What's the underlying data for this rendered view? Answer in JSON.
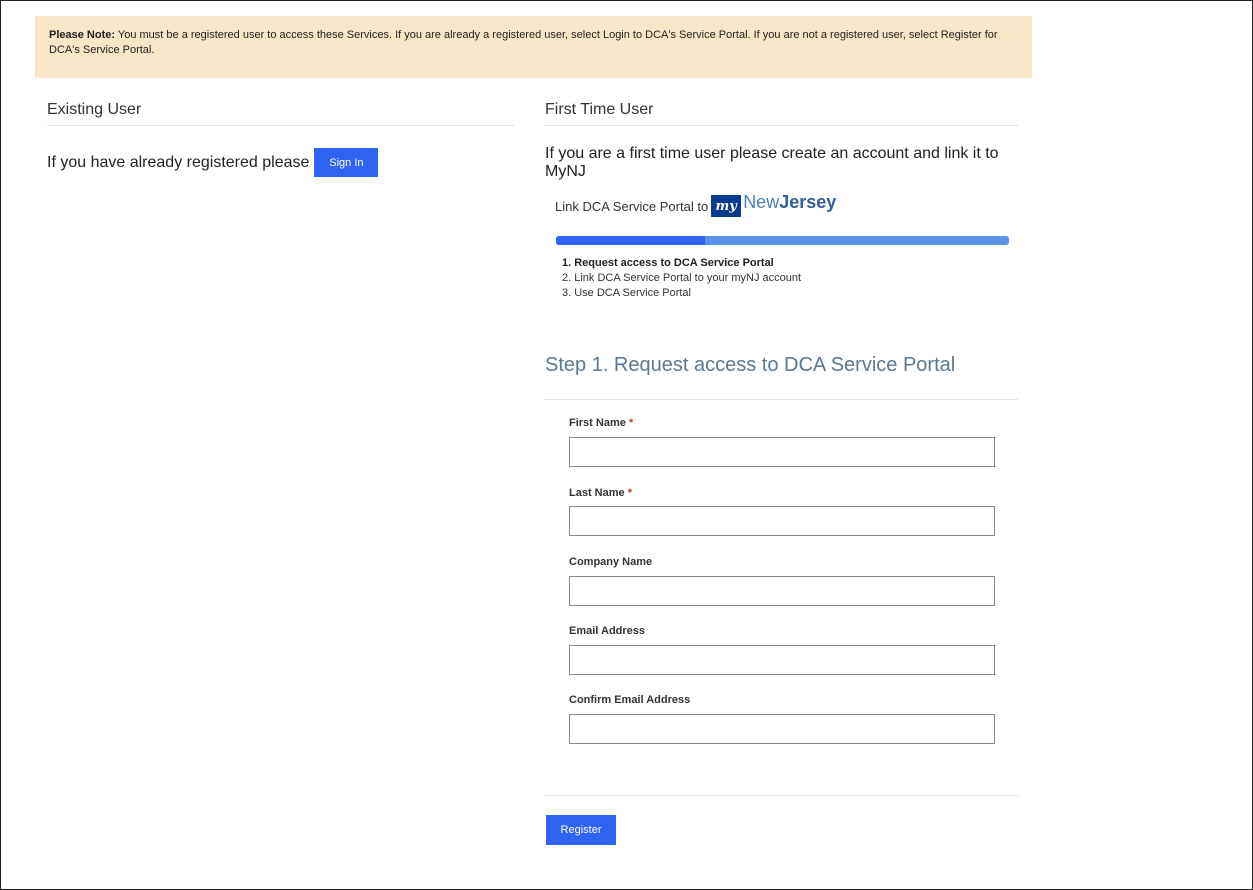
{
  "notice": {
    "label": "Please Note:",
    "text": " You must be a registered user to access these Services. If you are already a registered user, select Login to DCA's Service Portal. If you are not a registered user, select Register for DCA's Service Portal."
  },
  "existing_user": {
    "heading": "Existing User",
    "prompt": "If you have already registered please",
    "sign_in_label": "Sign In"
  },
  "first_time_user": {
    "heading": "First Time User",
    "intro": "If you are a first time user please create an account and link it to MyNJ",
    "link_text": "Link DCA Service Portal to",
    "logo": {
      "badge": "my",
      "word_light": "New",
      "word_bold": "Jersey"
    },
    "progress_fraction": 0.33,
    "steps": [
      "1. Request access to DCA Service Portal",
      "2. Link DCA Service Portal to your myNJ account",
      "3. Use DCA Service Portal"
    ],
    "active_step": 0
  },
  "form": {
    "title": "Step 1. Request access to DCA Service Portal",
    "fields": [
      {
        "label": "First Name",
        "required": "*",
        "value": ""
      },
      {
        "label": "Last Name",
        "required": "*",
        "value": ""
      },
      {
        "label": "Company Name",
        "required": "",
        "value": ""
      },
      {
        "label": "Email Address",
        "required": "",
        "value": ""
      },
      {
        "label": "Confirm Email Address",
        "required": "",
        "value": ""
      }
    ],
    "register_label": "Register"
  },
  "colors": {
    "notice_bg": "#f8e6c8",
    "button": "#2f63f2",
    "progress_track": "#5b93ea",
    "step_title": "#5a7893"
  }
}
